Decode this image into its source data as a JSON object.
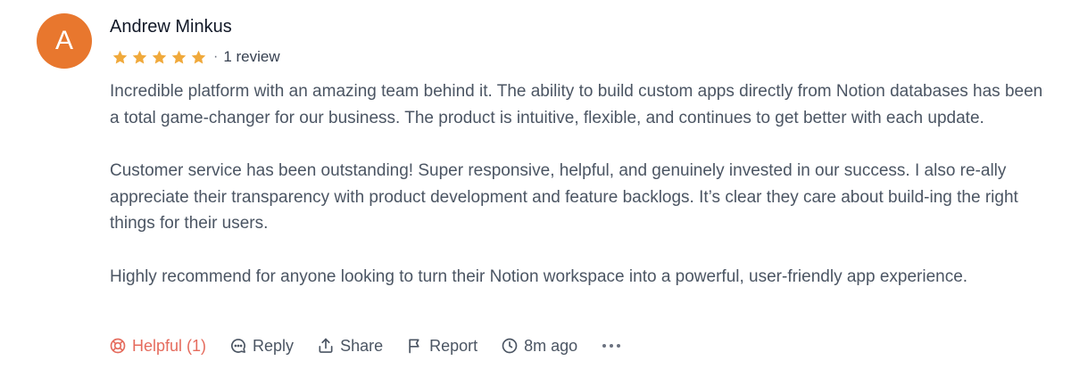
{
  "review": {
    "avatar_letter": "A",
    "author": "Andrew Minkus",
    "rating": 5,
    "rating_max": 5,
    "separator": "·",
    "review_count": "1 review",
    "paragraphs": [
      "Incredible platform with an amazing team behind it. The ability to build custom apps directly from Notion databases has been a total game-changer for our business. The product is intuitive, flexible, and continues to get better with each update.",
      "Customer service has been outstanding! Super responsive, helpful, and genuinely invested in our success. I also re-ally appreciate their transparency with product development and feature backlogs. It’s clear they care about build-ing the right things for their users.",
      "Highly recommend for anyone looking to turn their Notion workspace into a powerful, user-friendly app experience."
    ],
    "actions": {
      "helpful_label": "Helpful (1)",
      "reply_label": "Reply",
      "share_label": "Share",
      "report_label": "Report",
      "time_ago": "8m ago"
    }
  },
  "colors": {
    "avatar_bg": "#e8772e",
    "star": "#f0a93b",
    "helpful": "#e56b5d",
    "text": "#4b5563"
  },
  "icons": {
    "helpful": "lifebuoy-icon",
    "reply": "chat-bubble-icon",
    "share": "share-icon",
    "report": "flag-icon",
    "time": "clock-icon",
    "more": "more-icon"
  }
}
